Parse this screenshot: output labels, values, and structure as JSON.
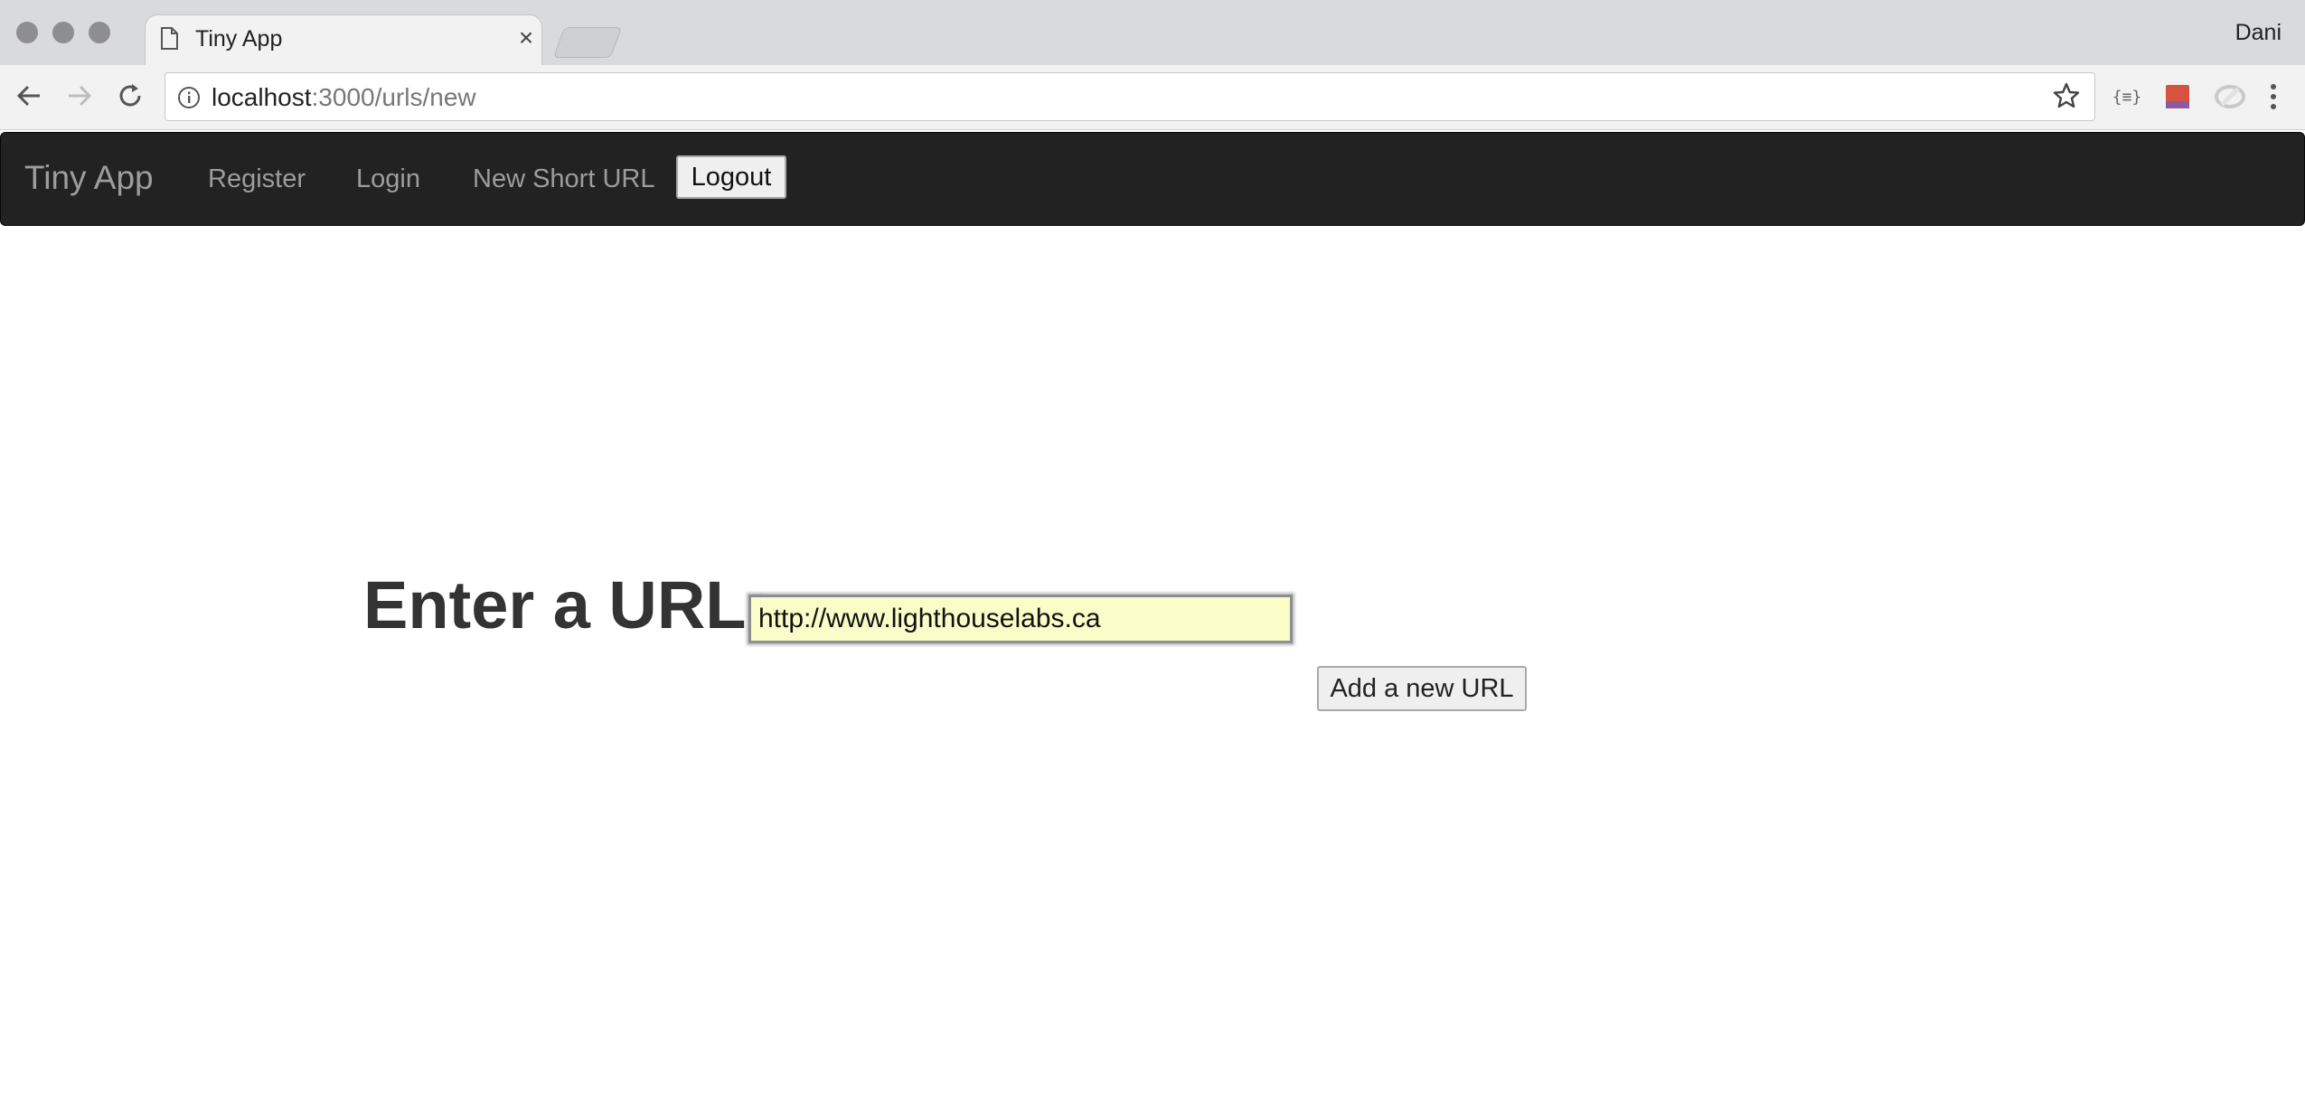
{
  "browser": {
    "tab_title": "Tiny App",
    "tab_close": "×",
    "profile_name": "Dani",
    "url_host": "localhost",
    "url_path": ":3000/urls/new",
    "icons": {
      "tab": "document-icon",
      "back": "back-arrow-icon",
      "forward": "forward-arrow-icon",
      "reload": "reload-icon",
      "site_info": "info-icon",
      "bookmark": "star-icon",
      "ext1": "json-viewer-extension-icon",
      "ext2": "red-extension-icon",
      "ext3": "gray-extension-icon",
      "menu": "kebab-menu-icon"
    },
    "ext_json_label": "{≡}"
  },
  "navbar": {
    "brand": "Tiny App",
    "links": [
      "Register",
      "Login",
      "New Short URL"
    ],
    "logout_label": "Logout",
    "bg_color": "#222222",
    "link_color": "#9d9d9d"
  },
  "form": {
    "label": "Enter a URL:",
    "input_value": "http://www.lighthouselabs.ca",
    "submit_label": "Add a new URL",
    "input_bg_color": "#fbfdc8"
  }
}
